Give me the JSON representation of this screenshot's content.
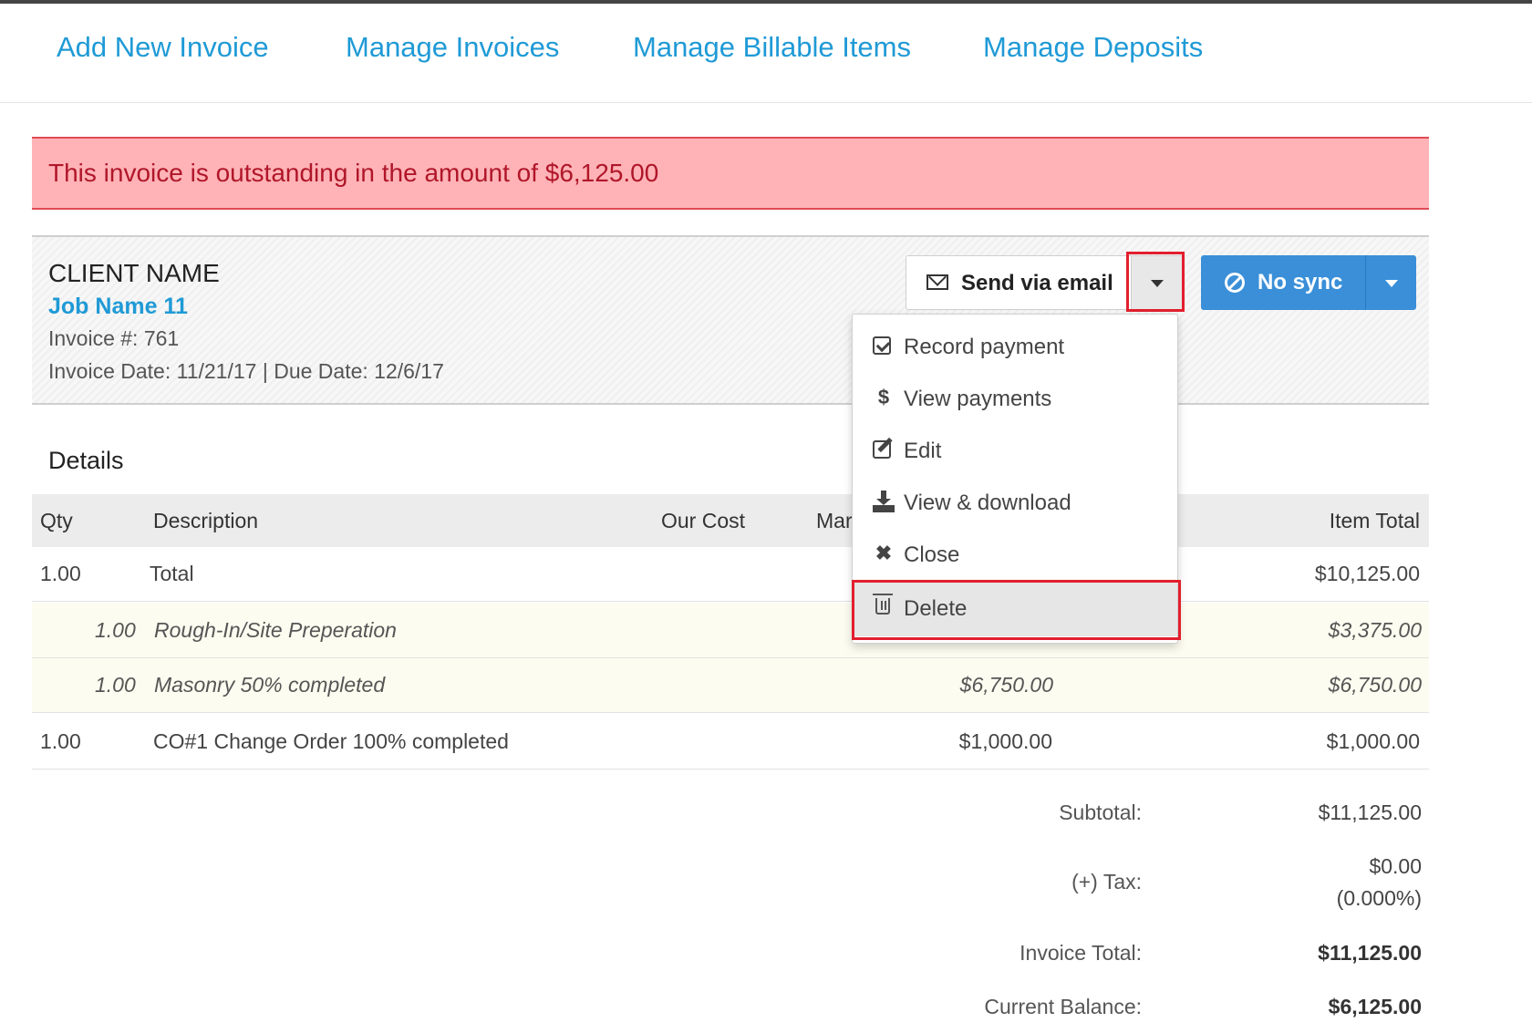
{
  "nav": {
    "items": [
      {
        "label": "Add New Invoice"
      },
      {
        "label": "Manage Invoices"
      },
      {
        "label": "Manage Billable Items"
      },
      {
        "label": "Manage Deposits"
      }
    ]
  },
  "alert": {
    "text": "This invoice is outstanding in the amount of $6,125.00"
  },
  "invoice": {
    "client_name": "CLIENT NAME",
    "job_name": "Job Name 11",
    "number_text": "Invoice #: 761",
    "dates_text": "Invoice Date: 11/21/17 | Due Date: 12/6/17"
  },
  "actions": {
    "send_label": "Send via email",
    "sync_label": "No sync",
    "icons": {
      "send": "envelope-icon",
      "sync": "ban-icon"
    }
  },
  "dropdown_menu": {
    "items": [
      {
        "label": "Record payment",
        "icon": "check-square-icon"
      },
      {
        "label": "View payments",
        "icon": "dollar-icon"
      },
      {
        "label": "Edit",
        "icon": "edit-icon"
      },
      {
        "label": "View & download",
        "icon": "download-icon"
      },
      {
        "label": "Close",
        "icon": "close-icon"
      },
      {
        "label": "Delete",
        "icon": "trash-icon"
      }
    ],
    "highlighted": "Delete"
  },
  "details": {
    "title": "Details",
    "columns": {
      "qty": "Qty",
      "description": "Description",
      "our_cost": "Our Cost",
      "markup": "Mar",
      "item_total": "Item Total"
    },
    "rows": [
      {
        "qty": "1.00",
        "description": "Total",
        "amount": "",
        "item_total": "$10,125.00"
      },
      {
        "qty": "1.00",
        "description": "Rough-In/Site Preperation",
        "amount": "",
        "item_total": "$3,375.00"
      },
      {
        "qty": "1.00",
        "description": "Masonry 50% completed",
        "amount": "$6,750.00",
        "item_total": "$6,750.00"
      },
      {
        "qty": "1.00",
        "description": "CO#1 Change Order 100% completed",
        "amount": "$1,000.00",
        "item_total": "$1,000.00"
      }
    ]
  },
  "totals": {
    "subtotal_label": "Subtotal:",
    "subtotal": "$11,125.00",
    "tax_label": "(+) Tax:",
    "tax": "$0.00",
    "tax_rate": "(0.000%)",
    "invoice_total_label": "Invoice Total:",
    "invoice_total": "$11,125.00",
    "balance_label": "Current Balance:",
    "balance": "$6,125.00"
  },
  "colors": {
    "link": "#1f9ad6",
    "alert_bg": "#ffb3b6",
    "alert_text": "#b0162a",
    "primary": "#3a8fd8",
    "highlight": "#e21f2e"
  }
}
